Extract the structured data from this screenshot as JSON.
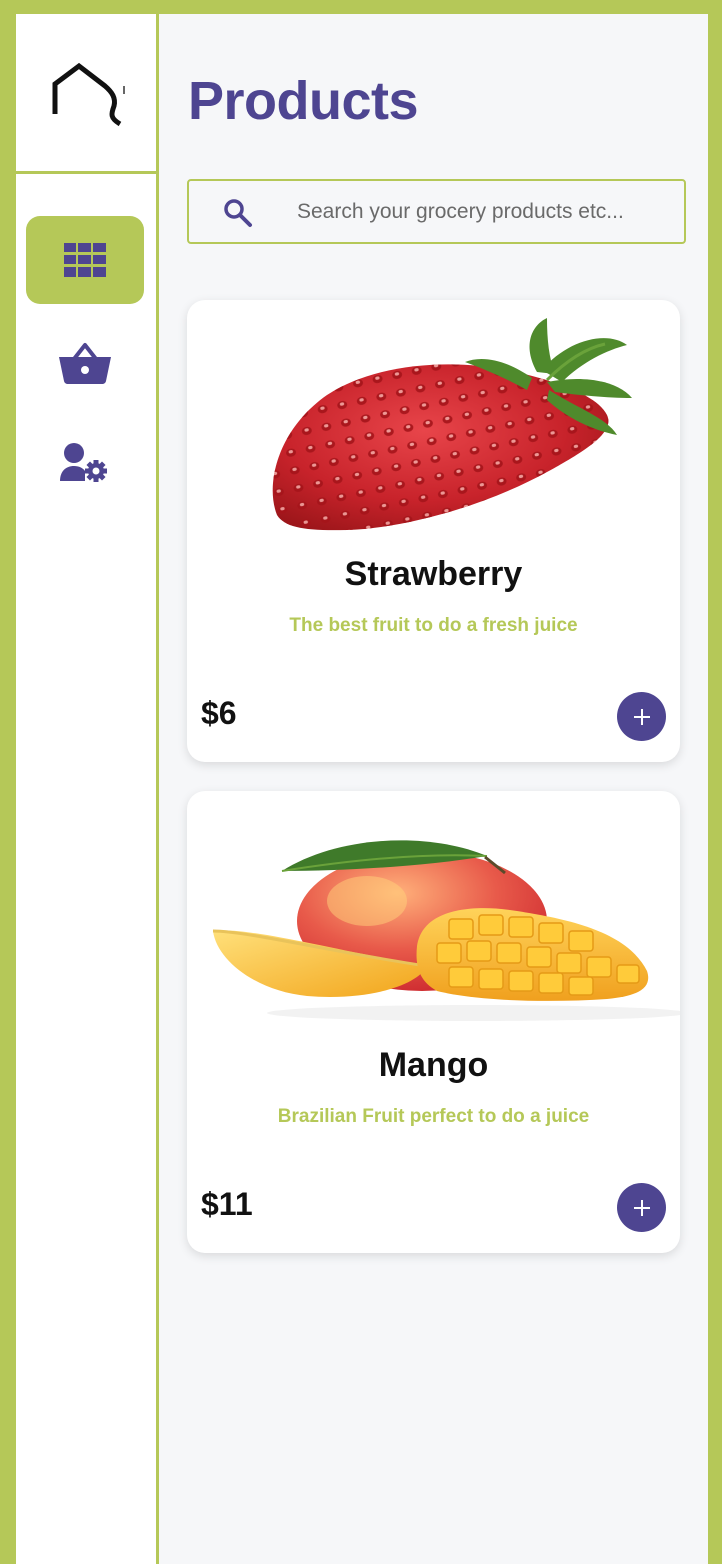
{
  "colors": {
    "accent": "#b5c858",
    "primary": "#4e4591",
    "background": "#f6f7f9"
  },
  "sidebar": {
    "logo_icon": "house-outline-logo",
    "items": [
      {
        "icon": "grid-icon",
        "active": true
      },
      {
        "icon": "basket-icon",
        "active": false
      },
      {
        "icon": "user-settings-icon",
        "active": false
      }
    ]
  },
  "main": {
    "title": "Products",
    "search": {
      "icon": "search-icon",
      "placeholder": "Search your grocery products etc..."
    },
    "products": [
      {
        "name": "Strawberry",
        "description": "The best fruit to do a fresh juice",
        "price": "$6",
        "add_icon": "plus-icon"
      },
      {
        "name": "Mango",
        "description": "Brazilian Fruit perfect to do a juice",
        "price": "$11",
        "add_icon": "plus-icon"
      }
    ]
  }
}
